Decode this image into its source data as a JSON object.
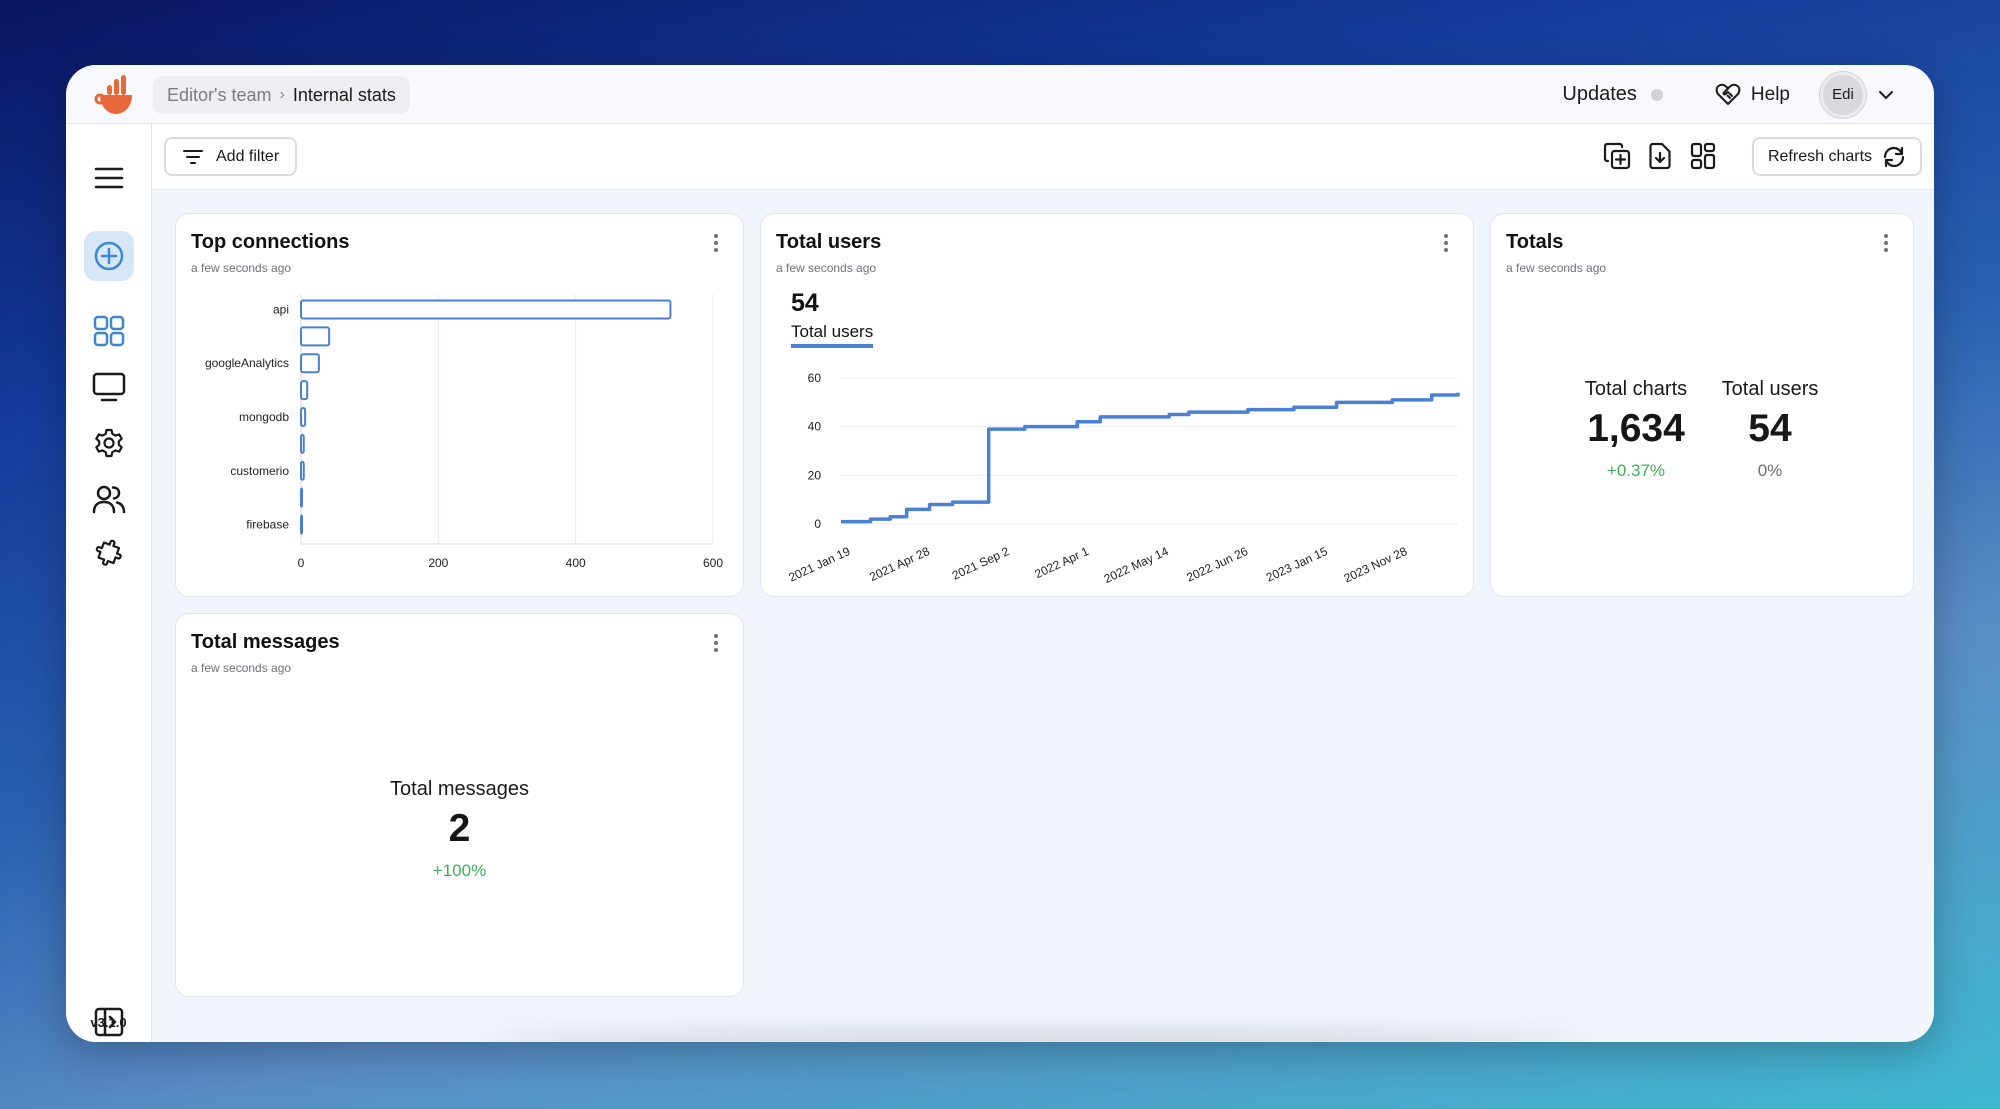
{
  "header": {
    "breadcrumb": {
      "team": "Editor's team",
      "separator": "›",
      "current": "Internal stats"
    },
    "updates_label": "Updates",
    "help_label": "Help",
    "avatar_initials": "Edi"
  },
  "sidebar": {
    "items": [
      {
        "name": "menu",
        "icon": "hamburger-menu-icon"
      },
      {
        "name": "create",
        "icon": "plus-circle-icon"
      },
      {
        "name": "dashboards",
        "icon": "grid-icon"
      },
      {
        "name": "displays",
        "icon": "monitor-icon"
      },
      {
        "name": "settings",
        "icon": "gear-icon"
      },
      {
        "name": "team",
        "icon": "users-icon"
      },
      {
        "name": "integrations",
        "icon": "puzzle-icon"
      },
      {
        "name": "expand",
        "icon": "sidebar-expand-icon"
      }
    ],
    "version": "v3.1.0"
  },
  "toolbar": {
    "add_filter_label": "Add filter",
    "icons": [
      "add-chart-icon",
      "export-icon",
      "layout-icon"
    ],
    "refresh_label": "Refresh charts"
  },
  "colors": {
    "accent": "#4a80d6",
    "positive": "#3cb15a",
    "neutral": "#6a6d72",
    "logo": "#e9683a"
  },
  "cards": {
    "top_connections": {
      "title": "Top connections",
      "updated": "a few seconds ago"
    },
    "total_users": {
      "title": "Total users",
      "updated": "a few seconds ago",
      "headline_value": "54",
      "legend_label": "Total users"
    },
    "totals": {
      "title": "Totals",
      "updated": "a few seconds ago",
      "kpis": [
        {
          "label": "Total charts",
          "value": "1,634",
          "change": "+0.37%",
          "trend": "positive"
        },
        {
          "label": "Total users",
          "value": "54",
          "change": "0%",
          "trend": "neutral"
        }
      ]
    },
    "total_messages": {
      "title": "Total messages",
      "updated": "a few seconds ago",
      "kpi": {
        "label": "Total messages",
        "value": "2",
        "change": "+100%",
        "trend": "positive"
      }
    }
  },
  "chart_data": [
    {
      "type": "bar",
      "orientation": "horizontal",
      "title": "Top connections",
      "categories": [
        "api",
        "",
        "googleAnalytics",
        "",
        "mongodb",
        "",
        "customerio",
        "",
        "firebase"
      ],
      "values": [
        538,
        41,
        26,
        9,
        6,
        4,
        4,
        1,
        0
      ],
      "xlim": [
        0,
        600
      ],
      "xticks": [
        "0",
        "200",
        "400",
        "600"
      ],
      "grid": true,
      "legend": "none"
    },
    {
      "type": "line",
      "step": true,
      "title": "Total users",
      "series": [
        {
          "name": "Total users",
          "x_index": [
            0,
            0.45,
            0.75,
            1.0,
            1.35,
            1.7,
            2.25,
            2.8,
            3.0,
            3.6,
            3.95,
            5.0,
            5.3,
            6.2,
            6.9,
            7.55,
            8.4,
            9.0,
            9.4
          ],
          "values": [
            1,
            2,
            3,
            6,
            8,
            9,
            39,
            40,
            40,
            42,
            44,
            45,
            46,
            47,
            48,
            50,
            51,
            53,
            54
          ]
        }
      ],
      "xticks": [
        "2021 Jan 19",
        "2021 Apr 28",
        "2021 Sep 2",
        "2022 Apr 1",
        "2022 May 14",
        "2022 Jun 26",
        "2023 Jan 15",
        "2023 Nov 28"
      ],
      "yticks": [
        "0",
        "20",
        "40",
        "60"
      ],
      "ylim": [
        0,
        60
      ],
      "grid": true,
      "legend": "top-left"
    }
  ]
}
